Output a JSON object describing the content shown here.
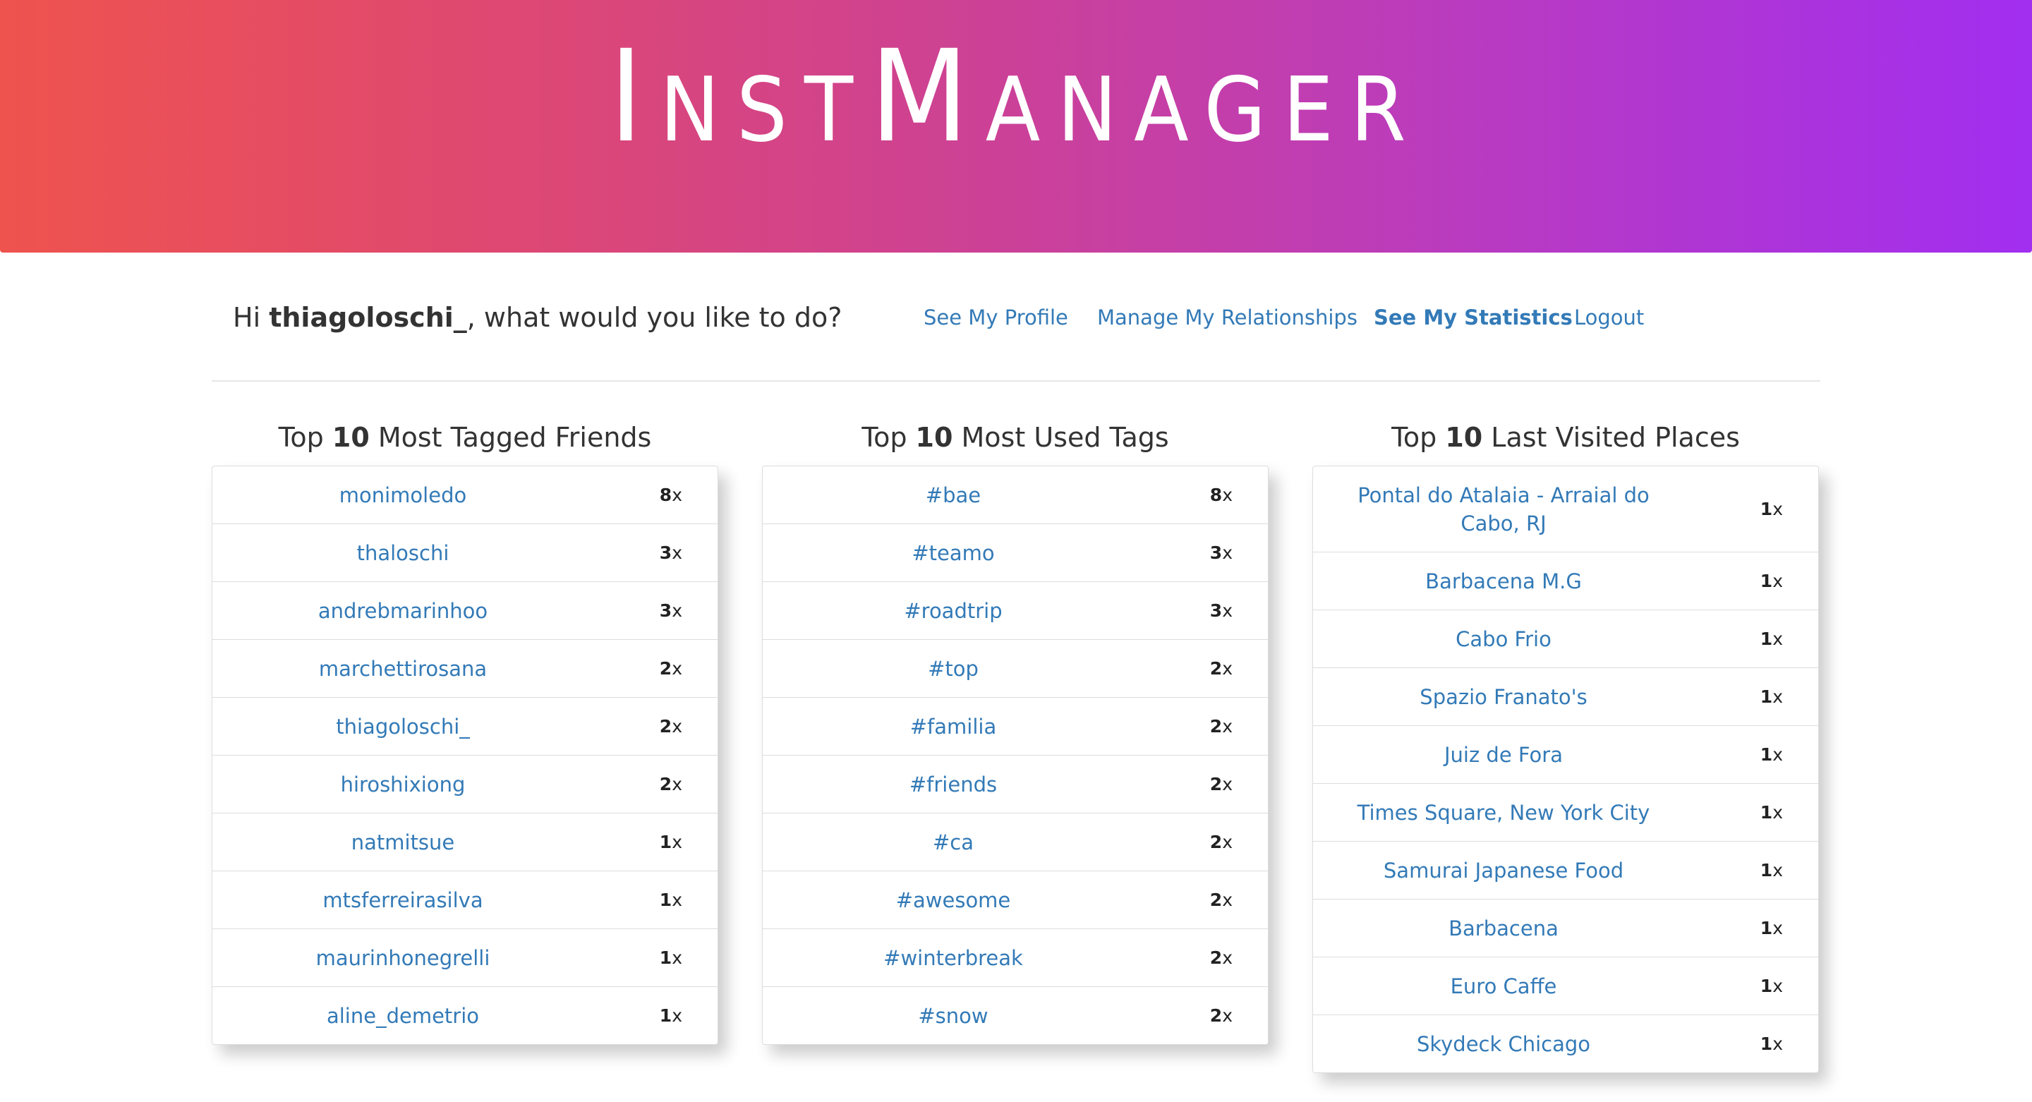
{
  "brand": {
    "title": "InstManager"
  },
  "greeting": {
    "prefix": "Hi ",
    "username": "thiagoloschi_",
    "suffix": ", what would you like to do?"
  },
  "nav": {
    "profile": "See My Profile",
    "relationships": "Manage My Relationships",
    "statistics": "See My Statistics",
    "logout": "Logout",
    "active": "statistics"
  },
  "panels": [
    {
      "title_prefix": "Top ",
      "title_num": "10",
      "title_suffix": " Most Tagged Friends",
      "items": [
        {
          "name": "monimoledo",
          "count": "8",
          "unit": "x"
        },
        {
          "name": "thaloschi",
          "count": "3",
          "unit": "x"
        },
        {
          "name": "andrebmarinhoo",
          "count": "3",
          "unit": "x"
        },
        {
          "name": "marchettirosana",
          "count": "2",
          "unit": "x"
        },
        {
          "name": "thiagoloschi_",
          "count": "2",
          "unit": "x"
        },
        {
          "name": "hiroshixiong",
          "count": "2",
          "unit": "x"
        },
        {
          "name": "natmitsue",
          "count": "1",
          "unit": "x"
        },
        {
          "name": "mtsferreirasilva",
          "count": "1",
          "unit": "x"
        },
        {
          "name": "maurinhonegrelli",
          "count": "1",
          "unit": "x"
        },
        {
          "name": "aline_demetrio",
          "count": "1",
          "unit": "x"
        }
      ]
    },
    {
      "title_prefix": "Top ",
      "title_num": "10",
      "title_suffix": " Most Used Tags",
      "items": [
        {
          "name": "#bae",
          "count": "8",
          "unit": "x"
        },
        {
          "name": "#teamo",
          "count": "3",
          "unit": "x"
        },
        {
          "name": "#roadtrip",
          "count": "3",
          "unit": "x"
        },
        {
          "name": "#top",
          "count": "2",
          "unit": "x"
        },
        {
          "name": "#familia",
          "count": "2",
          "unit": "x"
        },
        {
          "name": "#friends",
          "count": "2",
          "unit": "x"
        },
        {
          "name": "#ca",
          "count": "2",
          "unit": "x"
        },
        {
          "name": "#awesome",
          "count": "2",
          "unit": "x"
        },
        {
          "name": "#winterbreak",
          "count": "2",
          "unit": "x"
        },
        {
          "name": "#snow",
          "count": "2",
          "unit": "x"
        }
      ]
    },
    {
      "title_prefix": "Top ",
      "title_num": "10",
      "title_suffix": " Last Visited Places",
      "items": [
        {
          "name": "Pontal do Atalaia - Arraial do Cabo, RJ",
          "count": "1",
          "unit": "x"
        },
        {
          "name": "Barbacena M.G",
          "count": "1",
          "unit": "x"
        },
        {
          "name": "Cabo Frio",
          "count": "1",
          "unit": "x"
        },
        {
          "name": "Spazio Franato's",
          "count": "1",
          "unit": "x"
        },
        {
          "name": "Juiz de Fora",
          "count": "1",
          "unit": "x"
        },
        {
          "name": "Times Square, New York City",
          "count": "1",
          "unit": "x"
        },
        {
          "name": "Samurai Japanese Food",
          "count": "1",
          "unit": "x"
        },
        {
          "name": "Barbacena",
          "count": "1",
          "unit": "x"
        },
        {
          "name": "Euro Caffe",
          "count": "1",
          "unit": "x"
        },
        {
          "name": "Skydeck Chicago",
          "count": "1",
          "unit": "x"
        }
      ]
    }
  ],
  "colors": {
    "gradient_start": "#ef534e",
    "gradient_end": "#a22ef0",
    "link": "#337ab7"
  }
}
